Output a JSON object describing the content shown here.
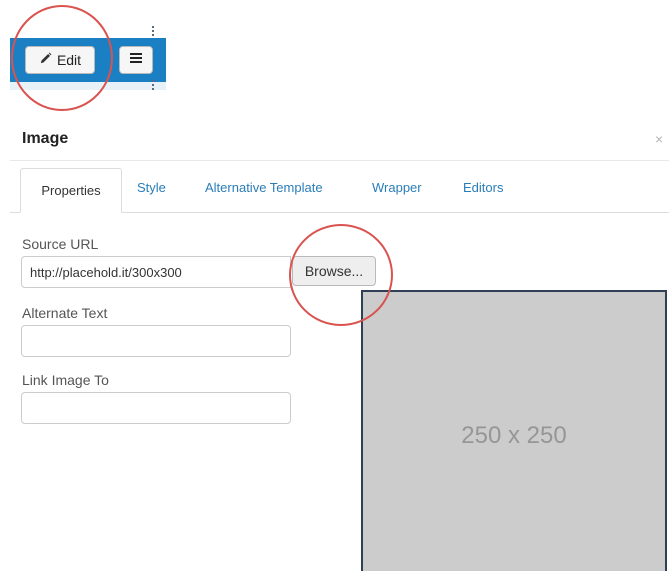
{
  "toolbar": {
    "edit_label": "Edit",
    "edit_icon": "pencil-icon",
    "menu_icon": "hamburger-icon"
  },
  "dialog": {
    "title": "Image",
    "close_icon": "close-icon",
    "close_glyph": "×",
    "tabs": [
      {
        "label": "Properties",
        "active": true
      },
      {
        "label": "Style"
      },
      {
        "label": "Alternative Template"
      },
      {
        "label": "Wrapper"
      },
      {
        "label": "Editors"
      }
    ],
    "fields": {
      "source_url": {
        "label": "Source URL",
        "value": "http://placehold.it/300x300"
      },
      "browse_label": "Browse...",
      "alternate_text": {
        "label": "Alternate Text",
        "value": ""
      },
      "link_image_to": {
        "label": "Link Image To",
        "value": ""
      }
    },
    "preview_text": "250 x 250"
  },
  "colors": {
    "toolbar_bg": "#1b7fc3",
    "tab_link": "#2a7db8",
    "highlight_ring": "#d9534f",
    "preview_bg": "#cccccc"
  }
}
